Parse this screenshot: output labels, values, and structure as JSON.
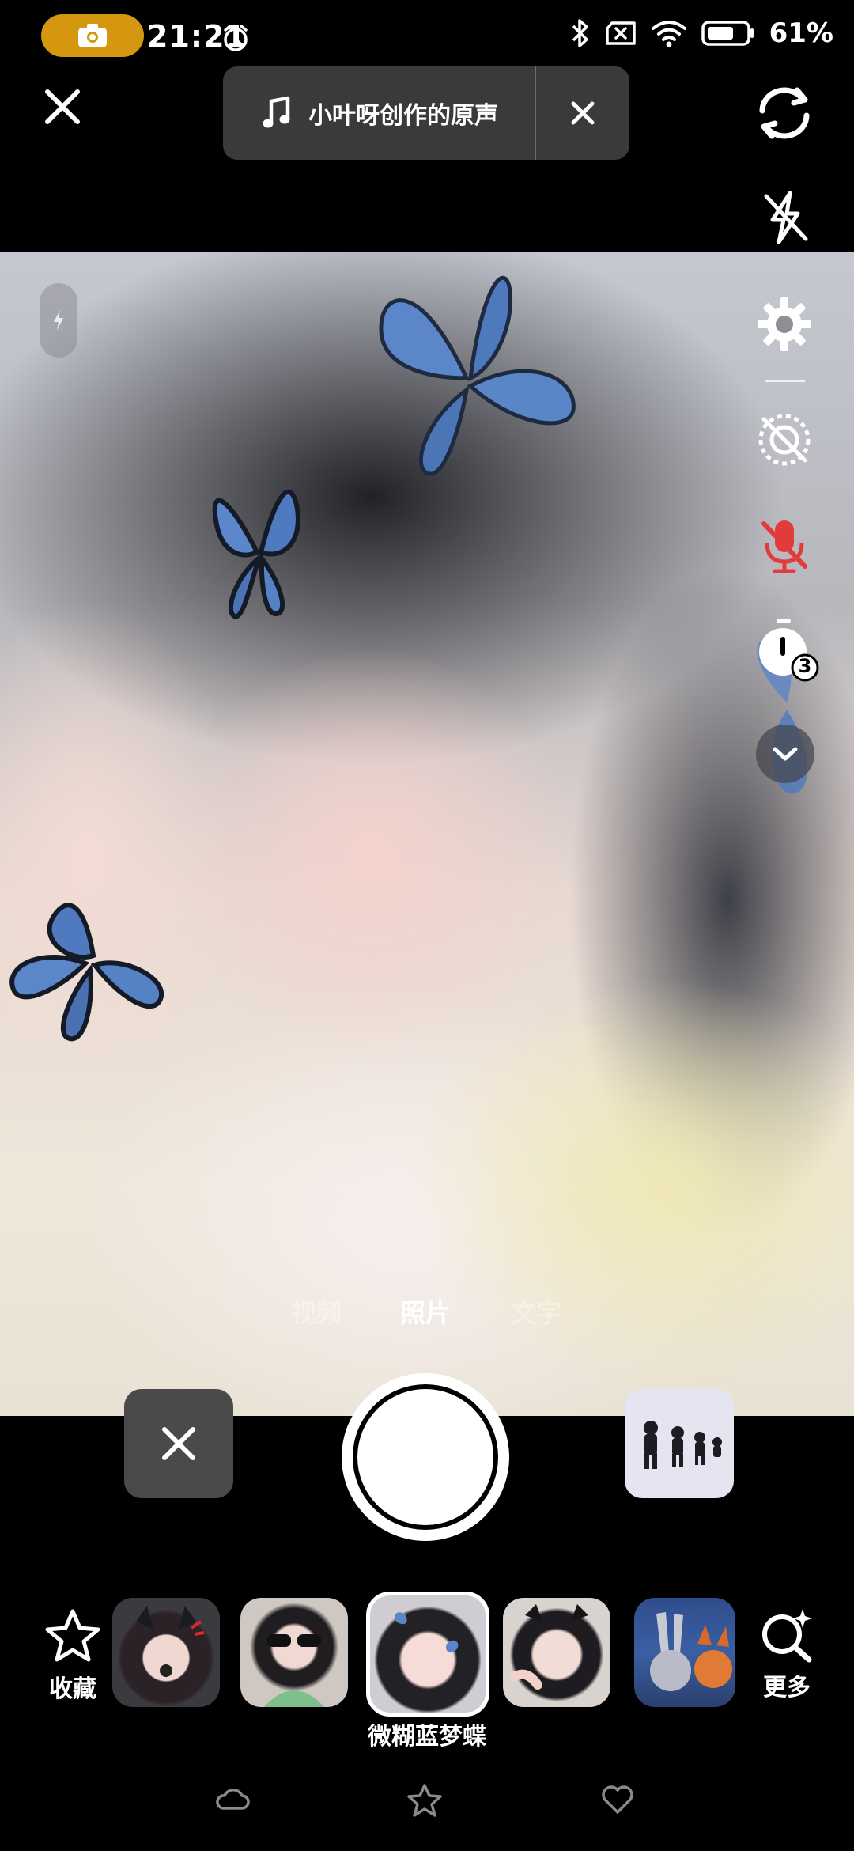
{
  "status_bar": {
    "time": "21:21",
    "battery": "61%",
    "icons": [
      "camera-icon",
      "alarm-icon",
      "bluetooth-icon",
      "sim-x-icon",
      "wifi-icon",
      "battery-icon"
    ]
  },
  "top_bar": {
    "close_icon": "close-icon",
    "music_title": "小叶呀创作的原声",
    "music_icon": "music-note-icon",
    "music_close_icon": "close-icon",
    "flip_icon": "flip-camera-icon"
  },
  "side_tools": [
    "flash-off-icon",
    "settings-icon",
    "beauty-off-icon",
    "mic-off-icon",
    "timer-icon",
    "expand-down-icon"
  ],
  "timer_badge": "3",
  "modes": {
    "video": "视频",
    "photo": "照片",
    "text": "文字",
    "active": "photo"
  },
  "effects_tray": {
    "favorites_label": "收藏",
    "more_label": "更多",
    "selected_effect_label": "微糊蓝梦蝶",
    "effect_count_visible": 5
  },
  "bottom_nav": [
    "cloud-icon",
    "star-icon",
    "heart-icon"
  ],
  "colors": {
    "accent_orange": "#d5970f",
    "mic_off_red": "#e23b3b",
    "pill_bg": "#3a3a3a"
  }
}
